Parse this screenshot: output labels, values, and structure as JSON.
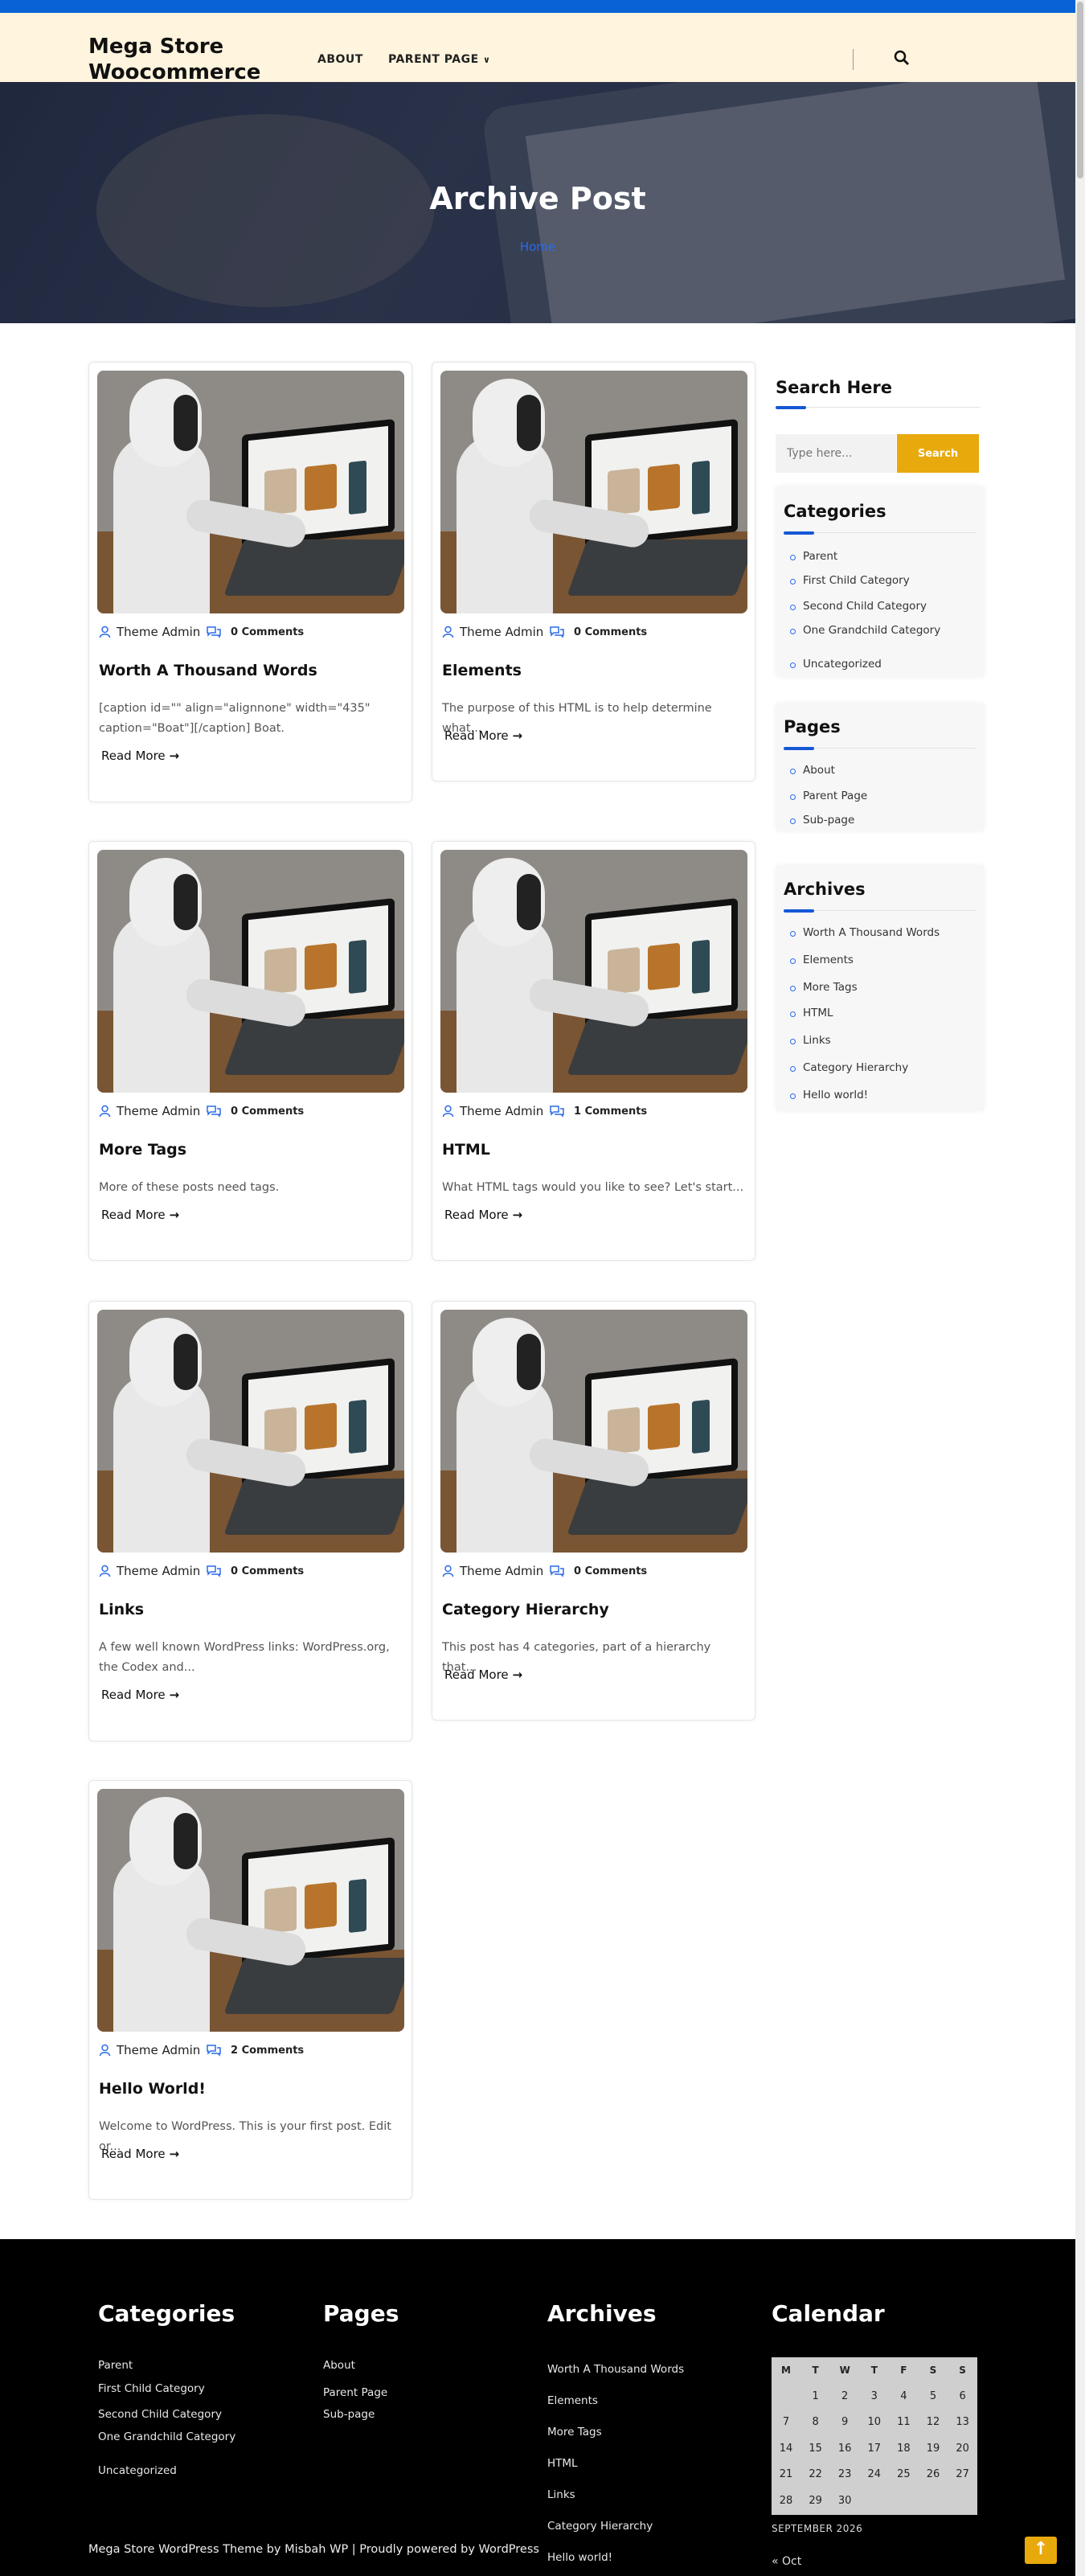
{
  "site": {
    "title": "Mega Store Woocommerce"
  },
  "nav": {
    "about": "ABOUT",
    "parent_page": "PARENT PAGE"
  },
  "hero": {
    "title": "Archive Post",
    "breadcrumb": "Home"
  },
  "posts": [
    {
      "author": "Theme Admin",
      "comments": "0 Comments",
      "title": "Worth A Thousand Words",
      "excerpt": "[caption id=\"\" align=\"alignnone\" width=\"435\" caption=\"Boat\"][/caption] Boat.",
      "read_more": "Read More"
    },
    {
      "author": "Theme Admin",
      "comments": "0 Comments",
      "title": "Elements",
      "excerpt": "The purpose of this HTML is to help determine what...",
      "read_more": "Read More"
    },
    {
      "author": "Theme Admin",
      "comments": "0 Comments",
      "title": "More Tags",
      "excerpt": "More of these posts need tags.",
      "read_more": "Read More"
    },
    {
      "author": "Theme Admin",
      "comments": "1 Comments",
      "title": "HTML",
      "excerpt": "What HTML tags would you like to see? Let's start...",
      "read_more": "Read More"
    },
    {
      "author": "Theme Admin",
      "comments": "0 Comments",
      "title": "Links",
      "excerpt": "A few well known WordPress links: WordPress.org, the Codex and...",
      "read_more": "Read More"
    },
    {
      "author": "Theme Admin",
      "comments": "0 Comments",
      "title": "Category Hierarchy",
      "excerpt": "This post has 4 categories, part of a hierarchy that...",
      "read_more": "Read More"
    },
    {
      "author": "Theme Admin",
      "comments": "2 Comments",
      "title": "Hello World!",
      "excerpt": "Welcome to WordPress. This is your first post. Edit or...",
      "read_more": "Read More"
    }
  ],
  "sidebar": {
    "search": {
      "title": "Search Here",
      "placeholder": "Type here...",
      "button": "Search"
    },
    "categories": {
      "title": "Categories",
      "items": [
        "Parent",
        "First Child Category",
        "Second Child Category",
        "One Grandchild Category",
        "Uncategorized"
      ]
    },
    "pages": {
      "title": "Pages",
      "items": [
        "About",
        "Parent Page",
        "Sub-page"
      ]
    },
    "archives": {
      "title": "Archives",
      "items": [
        "Worth A Thousand Words",
        "Elements",
        "More Tags",
        "HTML",
        "Links",
        "Category Hierarchy",
        "Hello world!"
      ]
    }
  },
  "footer": {
    "categories": {
      "title": "Categories",
      "items": [
        "Parent",
        "First Child Category",
        "Second Child Category",
        "One Grandchild Category",
        "Uncategorized"
      ]
    },
    "pages": {
      "title": "Pages",
      "items": [
        "About",
        "Parent Page",
        "Sub-page"
      ]
    },
    "archives": {
      "title": "Archives",
      "items": [
        "Worth A Thousand Words",
        "Elements",
        "More Tags",
        "HTML",
        "Links",
        "Category Hierarchy",
        "Hello world!"
      ]
    },
    "calendar": {
      "title": "Calendar",
      "days": [
        "M",
        "T",
        "W",
        "T",
        "F",
        "S",
        "S"
      ],
      "weeks": [
        [
          "",
          "1",
          "2",
          "3",
          "4",
          "5",
          "6"
        ],
        [
          "7",
          "8",
          "9",
          "10",
          "11",
          "12",
          "13"
        ],
        [
          "14",
          "15",
          "16",
          "17",
          "18",
          "19",
          "20"
        ],
        [
          "21",
          "22",
          "23",
          "24",
          "25",
          "26",
          "27"
        ],
        [
          "28",
          "29",
          "30",
          "",
          "",
          "",
          ""
        ]
      ],
      "caption": "SEPTEMBER 2026",
      "prev": "« Oct"
    },
    "copyright": "Mega Store WordPress Theme by Misbah WP | Proudly powered by WordPress"
  },
  "colors": {
    "accent": "#2b6be8",
    "button": "#e8a90c",
    "header_bg": "#fff4dd",
    "topbar": "#0a63d6"
  }
}
